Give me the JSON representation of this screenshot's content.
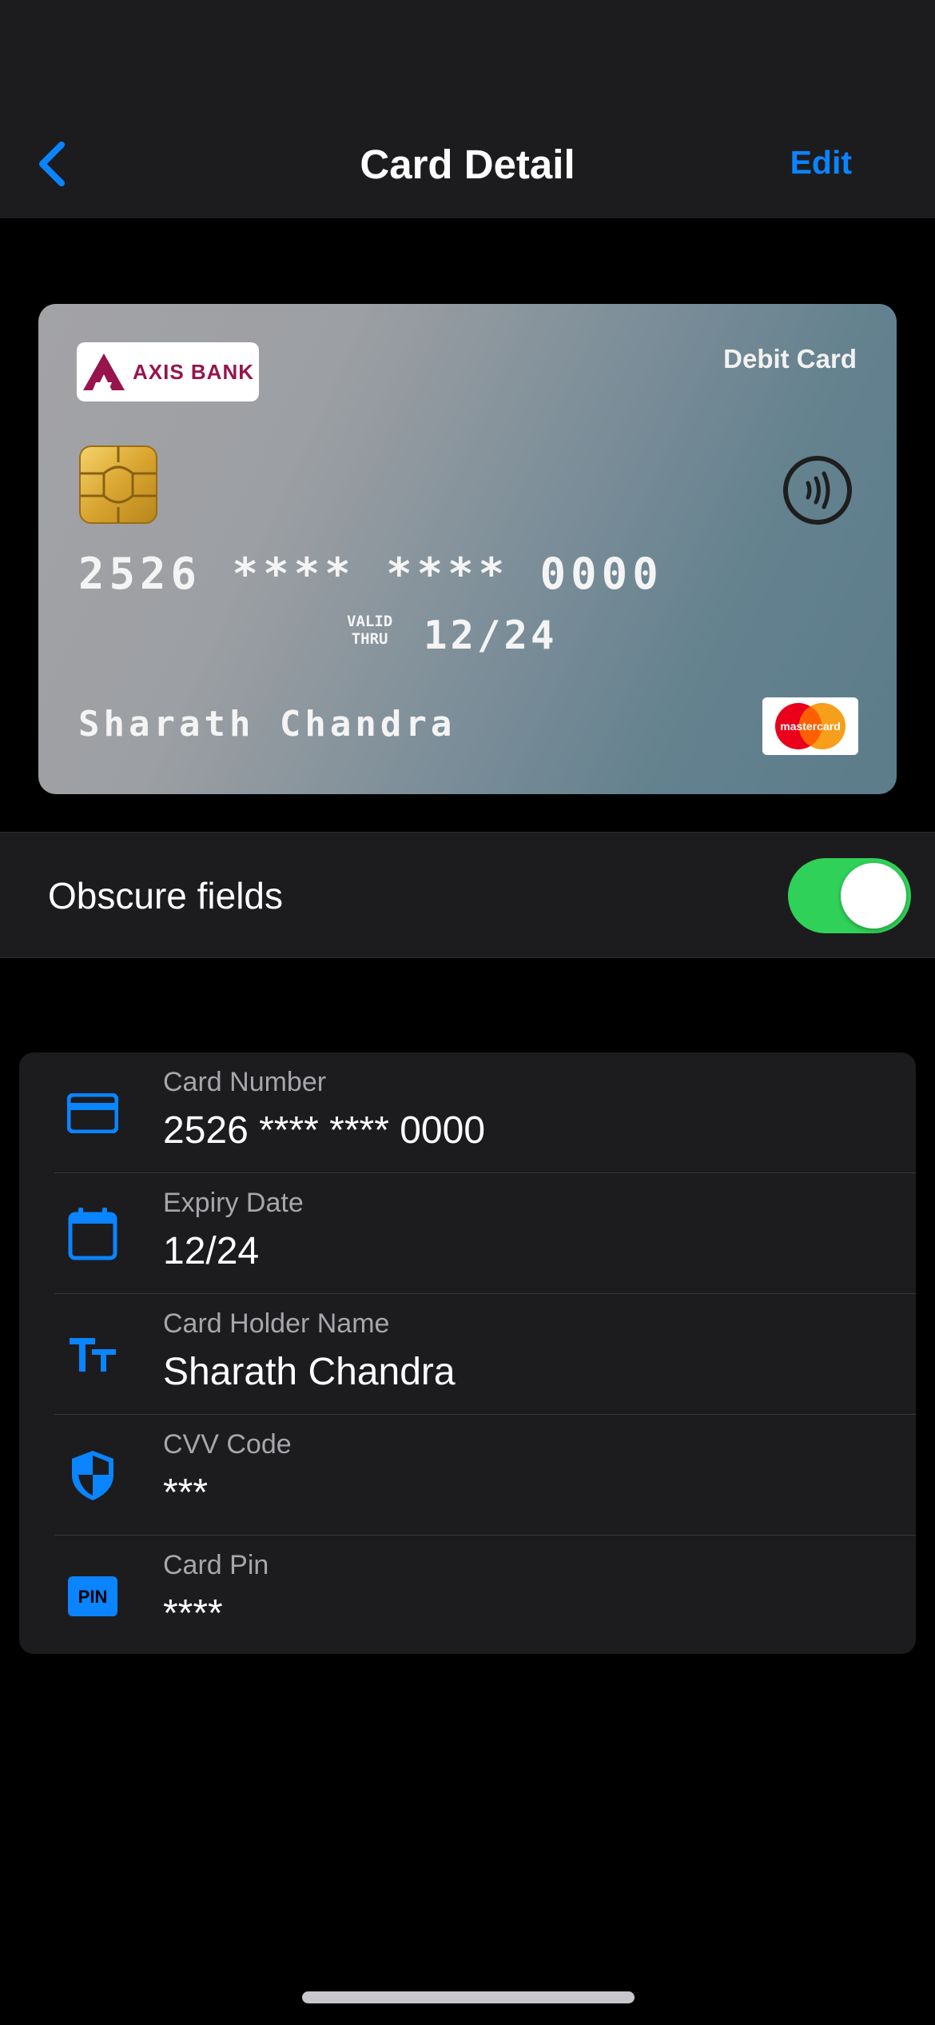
{
  "navbar": {
    "title": "Card Detail",
    "edit_label": "Edit",
    "back_icon": "chevron-left-icon",
    "accent_color": "#0a84ff"
  },
  "card": {
    "bank_name": "AXIS BANK",
    "type": "Debit Card",
    "number": "2526 **** **** 0000",
    "valid_thru_line1": "VALID",
    "valid_thru_line2": "THRU",
    "expiry": "12/24",
    "holder": "Sharath Chandra",
    "network_label": "mastercard",
    "brand_color": "#97144d"
  },
  "obscure": {
    "label": "Obscure fields",
    "enabled": true,
    "toggle_color": "#30d158"
  },
  "fields": [
    {
      "label": "Card Number",
      "value": "2526 **** **** 0000",
      "icon": "credit-card-icon"
    },
    {
      "label": "Expiry Date",
      "value": "12/24",
      "icon": "calendar-icon"
    },
    {
      "label": "Card Holder Name",
      "value": "Sharath Chandra",
      "icon": "text-size-icon"
    },
    {
      "label": "CVV Code",
      "value": "***",
      "icon": "shield-icon"
    },
    {
      "label": "Card Pin",
      "value": "****",
      "icon": "pin-icon",
      "icon_text": "PIN"
    }
  ]
}
